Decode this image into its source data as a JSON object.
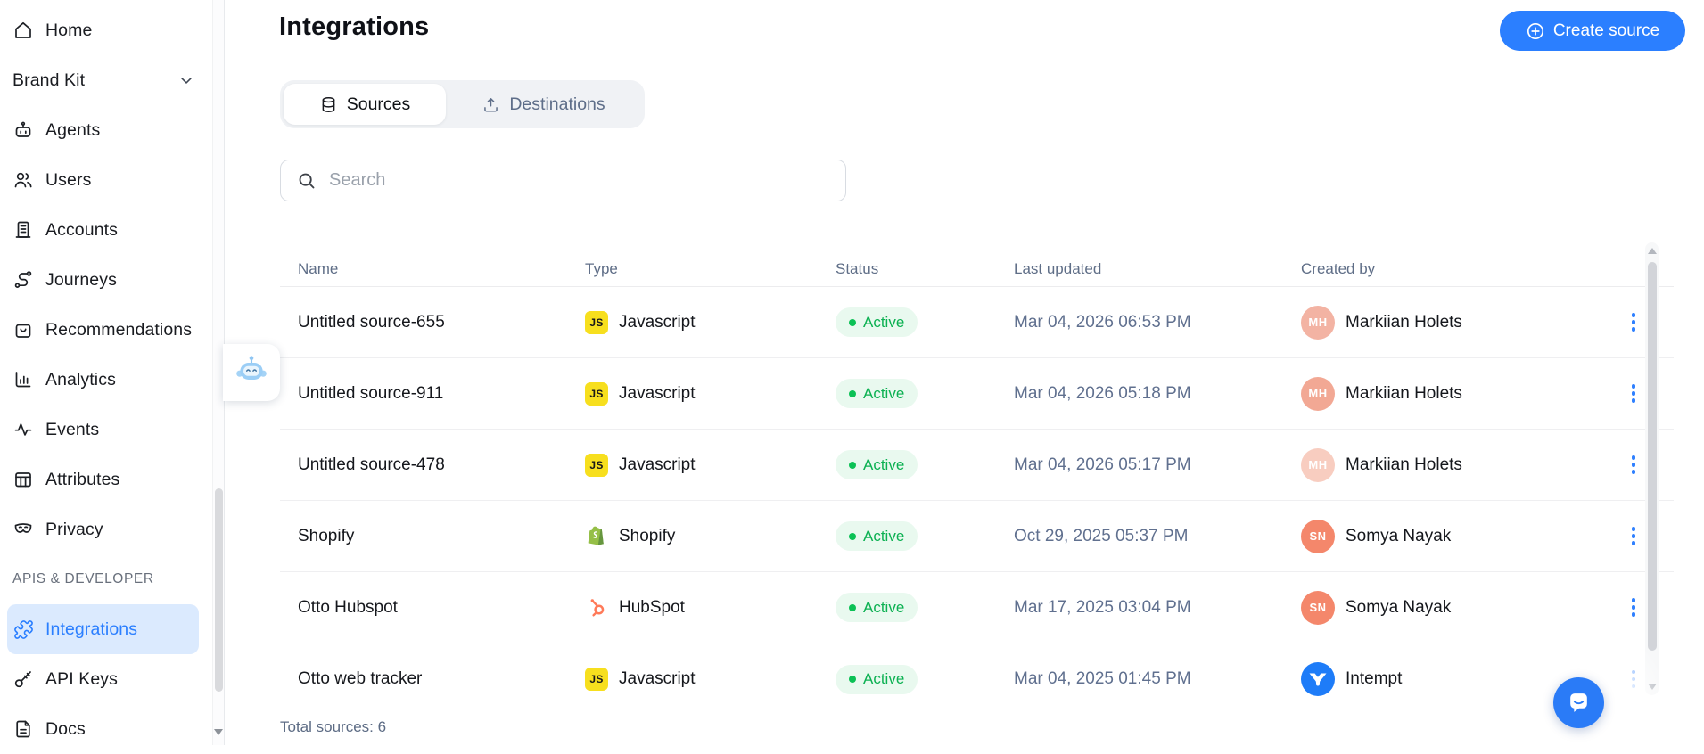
{
  "app": {
    "accent_color": "#2B7FFF"
  },
  "sidebar": {
    "section_label": "APIS & DEVELOPER",
    "items": [
      {
        "label": "Home"
      },
      {
        "label": "Brand Kit"
      },
      {
        "label": "Agents"
      },
      {
        "label": "Users"
      },
      {
        "label": "Accounts"
      },
      {
        "label": "Journeys"
      },
      {
        "label": "Recommendations"
      },
      {
        "label": "Analytics"
      },
      {
        "label": "Events"
      },
      {
        "label": "Attributes"
      },
      {
        "label": "Privacy"
      },
      {
        "label": "Integrations",
        "active": true
      },
      {
        "label": "API Keys"
      },
      {
        "label": "Docs"
      }
    ],
    "active_bg": "#DBEAFE",
    "active_color": "#2B7FFF"
  },
  "header": {
    "title": "Integrations",
    "create_source_label": "Create source"
  },
  "tabs": {
    "sources": "Sources",
    "destinations": "Destinations"
  },
  "search": {
    "placeholder": "Search"
  },
  "type_badges": {
    "javascript_label": "JS"
  },
  "status_colors": {
    "badge_bg": "#E9F9EF",
    "badge_text": "#0CB152",
    "dot": "#0BC155"
  },
  "type_colors": {
    "javascript_bg": "#F7DF1E",
    "shopify_green": "#95BF47",
    "hubspot_orange": "#FF7A59",
    "intempt_blue": "#1E7CF8"
  },
  "table": {
    "columns": {
      "name": "Name",
      "type": "Type",
      "status": "Status",
      "last_updated": "Last updated",
      "created_by": "Created by"
    },
    "rows": [
      {
        "name": "Untitled source-655",
        "type": "Javascript",
        "status": "Active",
        "last_updated": "Mar 04, 2026 06:53 PM",
        "created_by": "Markiian Holets",
        "avatar_initials": "MH",
        "avatar_color": "#F3B3A3"
      },
      {
        "name": "Untitled source-911",
        "type": "Javascript",
        "status": "Active",
        "last_updated": "Mar 04, 2026 05:18 PM",
        "created_by": "Markiian Holets",
        "avatar_initials": "MH",
        "avatar_color": "#F2A894"
      },
      {
        "name": "Untitled source-478",
        "type": "Javascript",
        "status": "Active",
        "last_updated": "Mar 04, 2026 05:17 PM",
        "created_by": "Markiian Holets",
        "avatar_initials": "MH",
        "avatar_color": "#F8CDC0"
      },
      {
        "name": "Shopify",
        "type": "Shopify",
        "status": "Active",
        "last_updated": "Oct 29, 2025 05:37 PM",
        "created_by": "Somya Nayak",
        "avatar_initials": "SN",
        "avatar_color": "#F4876B"
      },
      {
        "name": "Otto Hubspot",
        "type": "HubSpot",
        "status": "Active",
        "last_updated": "Mar 17, 2025 03:04 PM",
        "created_by": "Somya Nayak",
        "avatar_initials": "SN",
        "avatar_color": "#F4876B"
      },
      {
        "name": "Otto web tracker",
        "type": "Javascript",
        "status": "Active",
        "last_updated": "Mar 04, 2025 01:45 PM",
        "created_by": "Intempt",
        "avatar_initials": "",
        "avatar_color": "#1E7CF8"
      }
    ],
    "footer": "Total sources: 6"
  }
}
